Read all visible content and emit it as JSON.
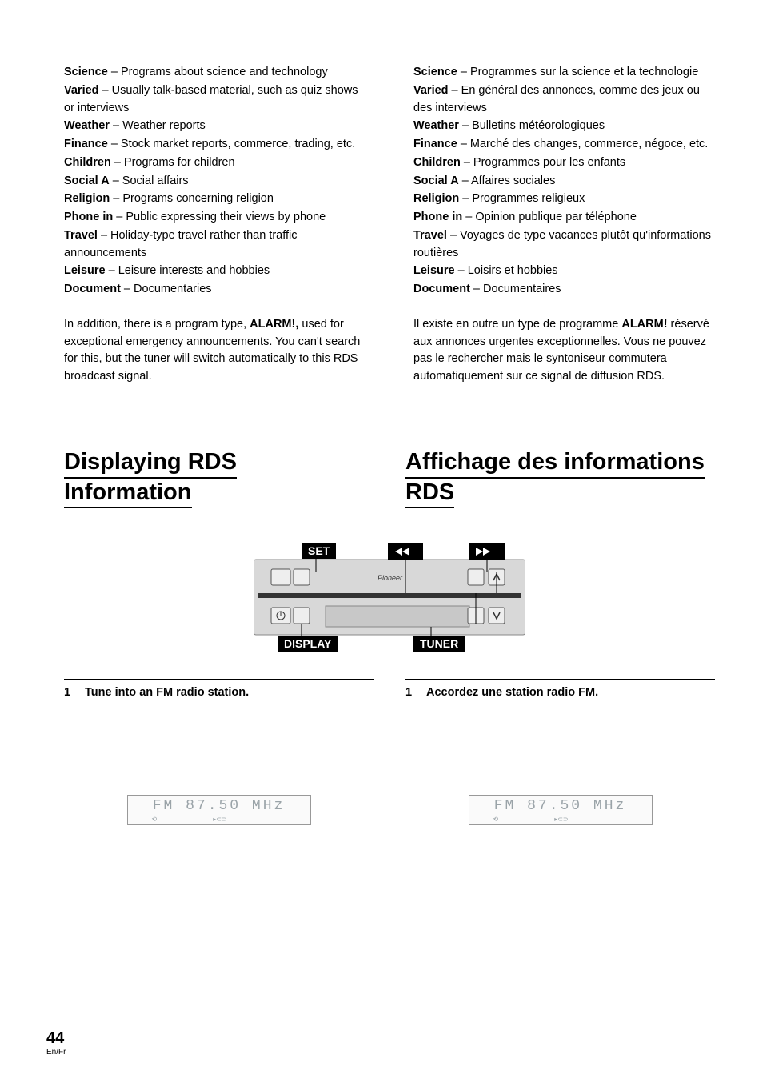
{
  "left": {
    "items1": [
      {
        "term": "Science",
        "desc": " – Programs about science and technology"
      },
      {
        "term": "Varied",
        "desc": " – Usually talk-based material, such as quiz shows or interviews"
      },
      {
        "term": "Weather",
        "desc": " – Weather reports"
      },
      {
        "term": "Finance",
        "desc": " – Stock market reports, commerce, trading, etc."
      },
      {
        "term": "Children",
        "desc": " – Programs for children"
      },
      {
        "term": "Social A",
        "desc": " – Social affairs"
      },
      {
        "term": "Religion",
        "desc": " – Programs concerning religion"
      },
      {
        "term": "Phone in",
        "desc": " – Public expressing their views by phone"
      },
      {
        "term": "Travel",
        "desc": " – Holiday-type travel rather than traffic announcements"
      },
      {
        "term": "Leisure",
        "desc": " – Leisure interests and hobbies"
      },
      {
        "term": "Document",
        "desc": " – Documentaries"
      }
    ],
    "alarm_pre": "In addition, there is a program type, ",
    "alarm_word": "ALARM!,",
    "alarm_post": " used for exceptional emergency announcements. You can't search for this, but the tuner will switch automatically to this RDS broadcast signal."
  },
  "right": {
    "items1": [
      {
        "term": "Science",
        "desc": " – Programmes sur la science et la technologie"
      },
      {
        "term": "Varied",
        "desc": " – En général des annonces, comme des jeux ou des interviews"
      },
      {
        "term": "Weather",
        "desc": " – Bulletins météorologiques"
      },
      {
        "term": "Finance",
        "desc": " – Marché des changes, commerce, négoce, etc."
      },
      {
        "term": "Children",
        "desc": " – Programmes pour les enfants"
      },
      {
        "term": "Social A",
        "desc": " – Affaires sociales"
      },
      {
        "term": "Religion",
        "desc": " – Programmes religieux"
      },
      {
        "term": "Phone in",
        "desc": " – Opinion publique par téléphone"
      },
      {
        "term": "Travel",
        "desc": " – Voyages de type vacances plutôt qu'informations routières"
      },
      {
        "term": "Leisure",
        "desc": " – Loisirs et hobbies"
      },
      {
        "term": "Document",
        "desc": " – Documentaires"
      }
    ],
    "alarm_pre": "Il existe en outre un type de programme ",
    "alarm_word": "ALARM!",
    "alarm_post": " réservé aux annonces urgentes exceptionnelles. Vous ne pouvez pas le rechercher mais le syntoniseur commutera automatiquement sur ce signal de diffusion RDS."
  },
  "headings": {
    "left_line1": "Displaying RDS",
    "left_line2": "Information",
    "right_line1": "Affichage des informations",
    "right_line2": "RDS"
  },
  "remote": {
    "set": "SET",
    "display": "DISPLAY",
    "tuner": "TUNER"
  },
  "steps": {
    "left_num": "1",
    "left_text": "Tune into an FM radio station.",
    "right_num": "1",
    "right_text": "Accordez une station radio FM."
  },
  "lcd": {
    "main": "FM  87.50 MHz",
    "icon1": "⟲",
    "icon2": "▸⊂⊃"
  },
  "footer": {
    "page": "44",
    "lang": "En/Fr"
  }
}
